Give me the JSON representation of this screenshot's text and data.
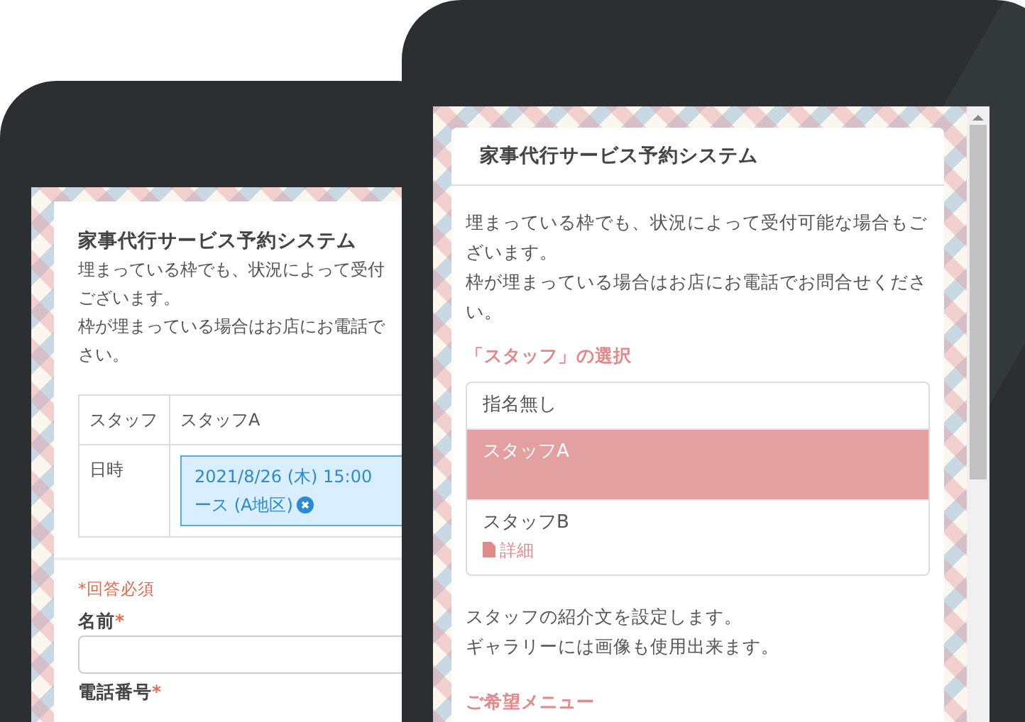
{
  "back_screen": {
    "title": "家事代行サービス予約システム",
    "description_lines": [
      "埋まっている枠でも、状況によって受付",
      "ございます。",
      "枠が埋まっている場合はお店にお電話で",
      "さい。"
    ],
    "summary": [
      {
        "label": "スタッフ",
        "kind": "text",
        "value_lines": [
          "スタッフA"
        ]
      },
      {
        "label": "日時",
        "kind": "chip",
        "value_lines": [
          "2021/8/26 (木) 15:00",
          "ース (A地区)"
        ]
      }
    ],
    "required_note": "*回答必須",
    "fields": [
      {
        "label": "名前",
        "required_mark": "*",
        "kind": "input"
      },
      {
        "label": "電話番号",
        "required_mark": "*",
        "kind": "label"
      }
    ]
  },
  "front_screen": {
    "title": "家事代行サービス予約システム",
    "description_lines": [
      "埋まっている枠でも、状況によって受付可能な場合もご",
      "ざいます。",
      "枠が埋まっている場合はお店にお電話でお問合せくださ",
      "い。"
    ],
    "section_title": "「スタッフ」の選択",
    "staff_options": [
      {
        "name": "指名無し",
        "selected": false
      },
      {
        "name": "スタッフA",
        "selected": true
      },
      {
        "name": "スタッフB",
        "selected": false,
        "detail_link": "詳細"
      }
    ],
    "staff_note_lines": [
      "スタッフの紹介文を設定します。",
      "ギャラリーには画像も使用出来ます。"
    ],
    "next_section_title": "ご希望メニュー"
  }
}
